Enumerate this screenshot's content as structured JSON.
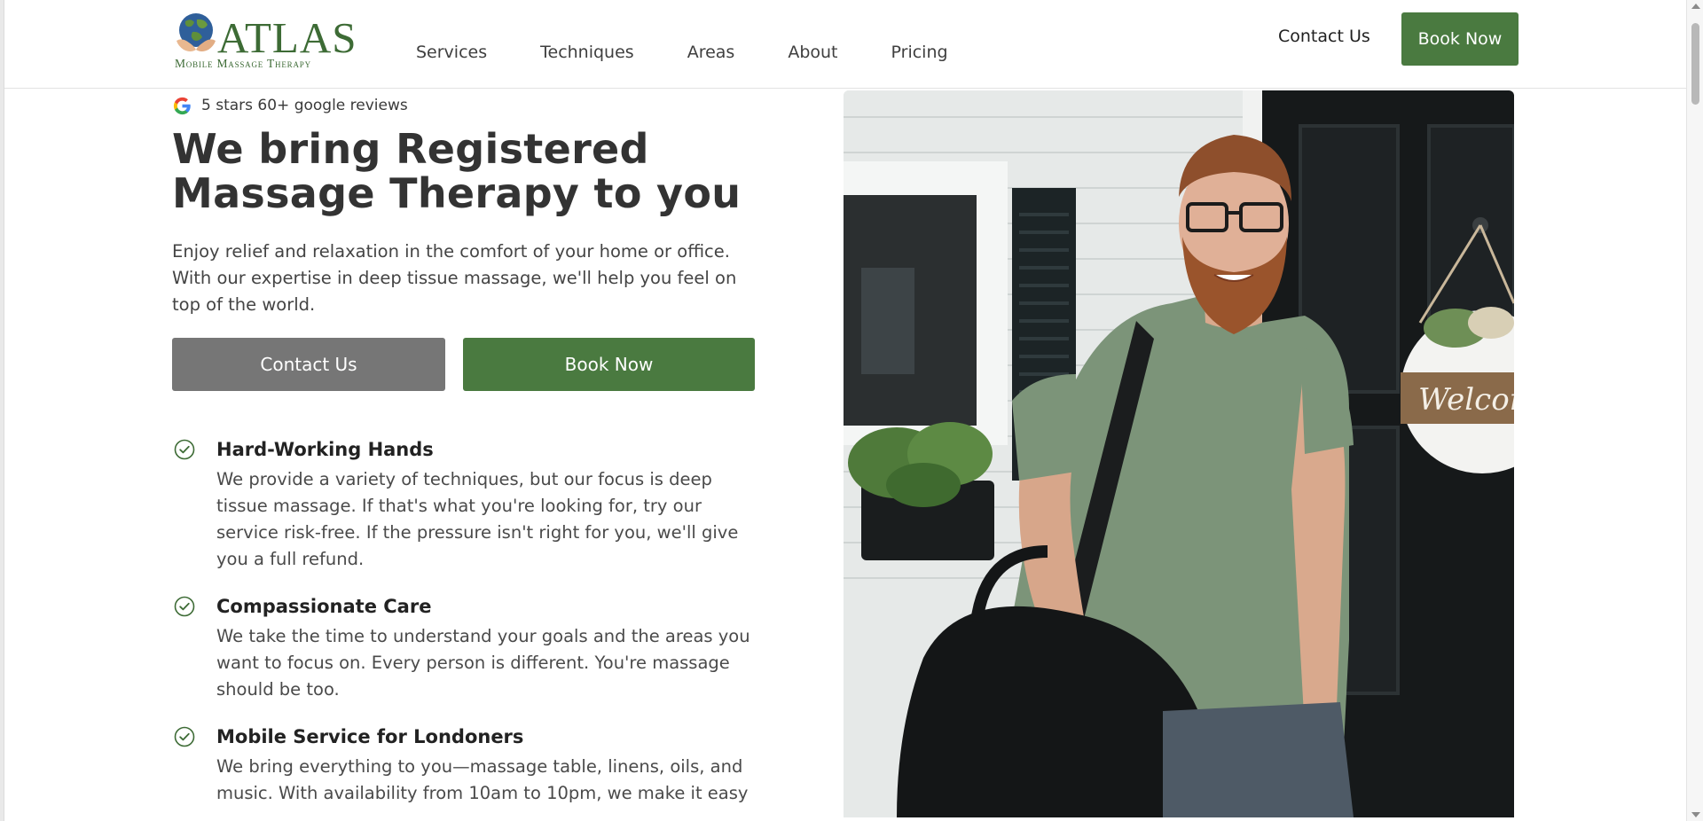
{
  "header": {
    "logo": {
      "name": "ATLAS",
      "tagline": "Mobile Massage Therapy"
    },
    "nav": [
      {
        "label": "Services"
      },
      {
        "label": "Techniques"
      },
      {
        "label": "Areas"
      },
      {
        "label": "About"
      },
      {
        "label": "Pricing"
      }
    ],
    "contact_label": "Contact Us",
    "book_label": "Book Now"
  },
  "hero": {
    "reviews_text": "5 stars 60+ google reviews",
    "title": "We bring Registered Massage Therapy to you",
    "lead": "Enjoy relief and relaxation in the comfort of your home or office. With our expertise in deep tissue massage, we'll help you feel on top of the world.",
    "contact_button": "Contact Us",
    "book_button": "Book Now",
    "features": [
      {
        "title": "Hard-Working Hands",
        "text": "We provide a variety of techniques, but our focus is deep tissue massage. If that's what you're looking for, try our service risk-free. If the pressure isn't right for you, we'll give you a full refund."
      },
      {
        "title": "Compassionate Care",
        "text": "We take the time to understand your goals and the areas you want to focus on. Every person is different. You're massage should be too."
      },
      {
        "title": "Mobile Service for Londoners",
        "text": "We bring everything to you—massage table, linens, oils, and music. With availability from 10am to 10pm, we make it easy"
      }
    ],
    "photo_sign_text": "Welcome"
  },
  "colors": {
    "brand_green": "#4a7a40",
    "button_gray": "#767676",
    "text": "#333333"
  },
  "icons": {
    "reviews": "google-g-icon",
    "feature": "check-circle-icon"
  }
}
